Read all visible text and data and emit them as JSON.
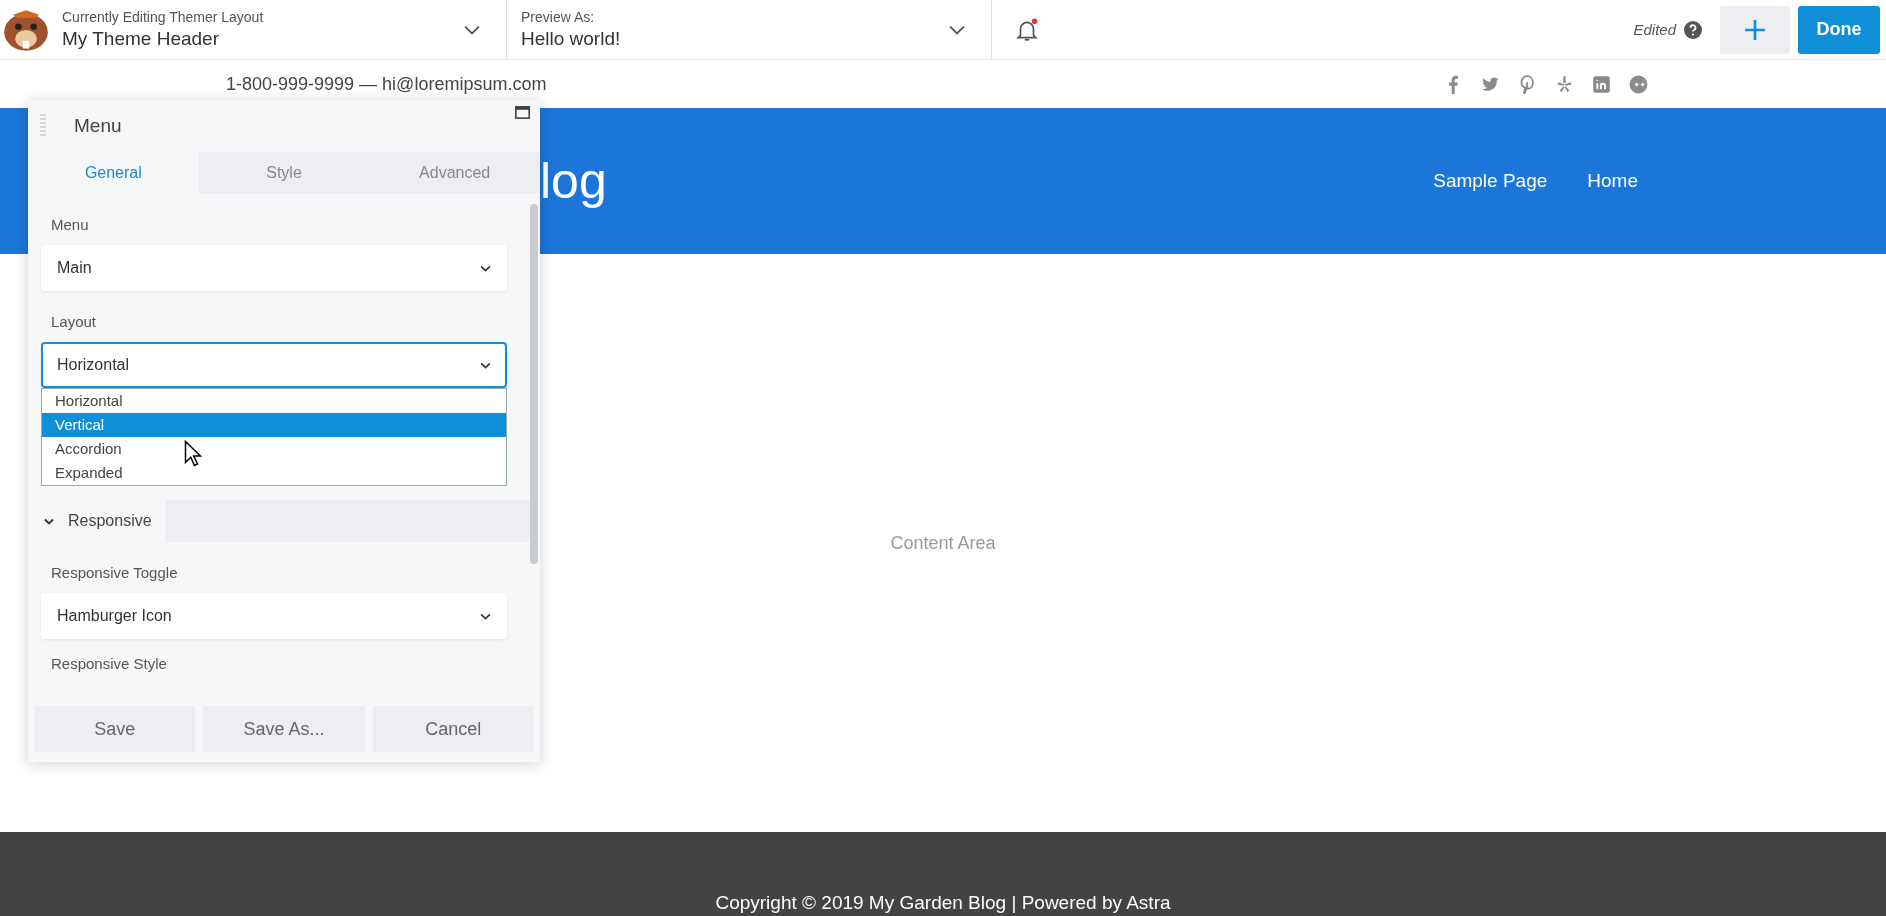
{
  "builder_bar": {
    "layout_label": "Currently Editing Themer Layout",
    "layout_name": "My Theme Header",
    "preview_label": "Preview As:",
    "preview_value": "Hello world!",
    "notification_unread": true,
    "status": "Edited",
    "done_button": "Done"
  },
  "site": {
    "contact": "1-800-999-9999 — hi@loremipsum.com",
    "title": "log",
    "nav": [
      {
        "label": "Sample Page"
      },
      {
        "label": "Home"
      }
    ],
    "content_placeholder": "Content Area",
    "footer": "Copyright © 2019 My Garden Blog | Powered by Astra"
  },
  "panel": {
    "title": "Menu",
    "tabs": [
      {
        "label": "General",
        "selected": true
      },
      {
        "label": "Style",
        "selected": false
      },
      {
        "label": "Advanced",
        "selected": false
      }
    ],
    "fields": [
      {
        "label": "Menu",
        "value": "Main",
        "focused": false
      },
      {
        "label": "Layout",
        "value": "Horizontal",
        "focused": true,
        "options": [
          {
            "label": "Horizontal",
            "highlighted": false
          },
          {
            "label": "Vertical",
            "highlighted": true
          },
          {
            "label": "Accordion",
            "highlighted": false
          },
          {
            "label": "Expanded",
            "highlighted": false
          }
        ]
      }
    ],
    "section": {
      "title": "Responsive",
      "expanded": true,
      "fields": [
        {
          "label": "Responsive Toggle",
          "value": "Hamburger Icon"
        }
      ],
      "next_label": "Responsive Style"
    },
    "buttons": [
      {
        "label": "Save"
      },
      {
        "label": "Save As..."
      },
      {
        "label": "Cancel"
      }
    ]
  }
}
